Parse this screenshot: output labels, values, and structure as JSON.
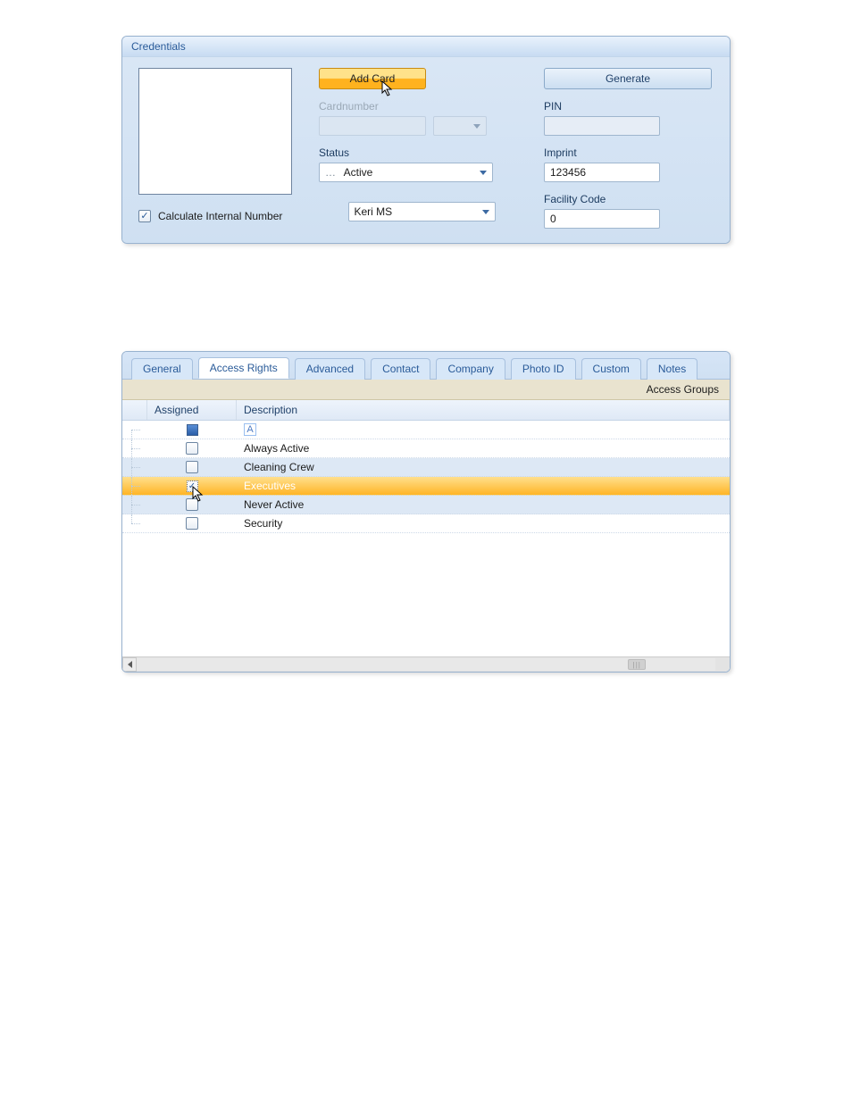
{
  "credentials": {
    "title": "Credentials",
    "add_card_label": "Add Card",
    "cardnumber_label": "Cardnumber",
    "cardnumber_value": "",
    "status_label": "Status",
    "status_value": "Active",
    "calculate_internal_label": "Calculate Internal Number",
    "calculate_internal_checked": true,
    "format_value": "Keri MS",
    "generate_label": "Generate",
    "pin_label": "PIN",
    "pin_value": "",
    "imprint_label": "Imprint",
    "imprint_value": "123456",
    "facility_label": "Facility Code",
    "facility_value": "0"
  },
  "tabs": {
    "items": [
      {
        "label": "General",
        "active": false
      },
      {
        "label": "Access Rights",
        "active": true
      },
      {
        "label": "Advanced",
        "active": false
      },
      {
        "label": "Contact",
        "active": false
      },
      {
        "label": "Company",
        "active": false
      },
      {
        "label": "Photo ID",
        "active": false
      },
      {
        "label": "Custom",
        "active": false
      },
      {
        "label": "Notes",
        "active": false
      }
    ]
  },
  "access": {
    "area_title": "Access Groups",
    "columns": {
      "assigned": "Assigned",
      "description": "Description"
    },
    "rows": [
      {
        "assigned": "all",
        "description": "",
        "editing": true,
        "alt": false,
        "selected": false
      },
      {
        "assigned": "none",
        "description": "Always Active",
        "editing": false,
        "alt": false,
        "selected": false
      },
      {
        "assigned": "none",
        "description": "Cleaning Crew",
        "editing": false,
        "alt": true,
        "selected": false
      },
      {
        "assigned": "checked",
        "description": "Executives",
        "editing": false,
        "alt": false,
        "selected": true
      },
      {
        "assigned": "none",
        "description": "Never Active",
        "editing": false,
        "alt": true,
        "selected": false
      },
      {
        "assigned": "none",
        "description": "Security",
        "editing": false,
        "alt": false,
        "selected": false
      }
    ]
  }
}
